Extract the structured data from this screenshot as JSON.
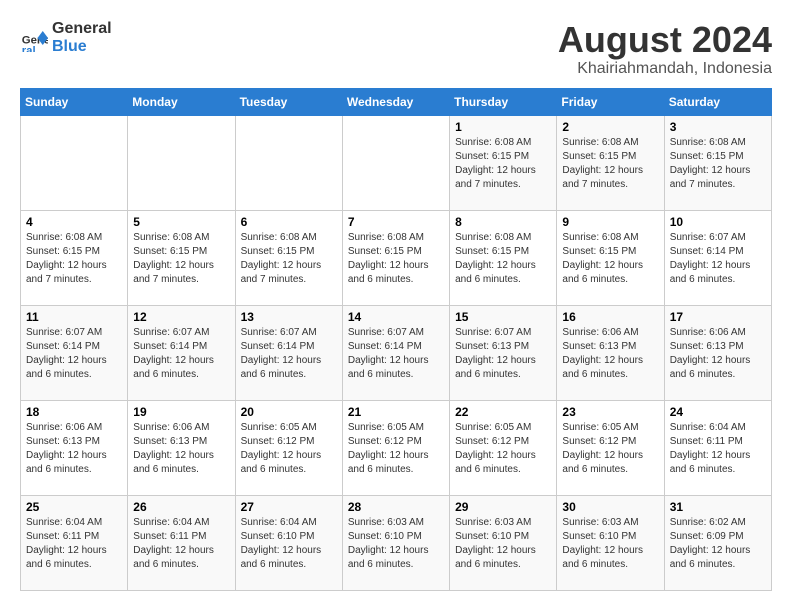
{
  "logo": {
    "line1": "General",
    "line2": "Blue"
  },
  "title": "August 2024",
  "subtitle": "Khairiahmandah, Indonesia",
  "days_header": [
    "Sunday",
    "Monday",
    "Tuesday",
    "Wednesday",
    "Thursday",
    "Friday",
    "Saturday"
  ],
  "weeks": [
    [
      {
        "day": "",
        "info": ""
      },
      {
        "day": "",
        "info": ""
      },
      {
        "day": "",
        "info": ""
      },
      {
        "day": "",
        "info": ""
      },
      {
        "day": "1",
        "info": "Sunrise: 6:08 AM\nSunset: 6:15 PM\nDaylight: 12 hours\nand 7 minutes."
      },
      {
        "day": "2",
        "info": "Sunrise: 6:08 AM\nSunset: 6:15 PM\nDaylight: 12 hours\nand 7 minutes."
      },
      {
        "day": "3",
        "info": "Sunrise: 6:08 AM\nSunset: 6:15 PM\nDaylight: 12 hours\nand 7 minutes."
      }
    ],
    [
      {
        "day": "4",
        "info": "Sunrise: 6:08 AM\nSunset: 6:15 PM\nDaylight: 12 hours\nand 7 minutes."
      },
      {
        "day": "5",
        "info": "Sunrise: 6:08 AM\nSunset: 6:15 PM\nDaylight: 12 hours\nand 7 minutes."
      },
      {
        "day": "6",
        "info": "Sunrise: 6:08 AM\nSunset: 6:15 PM\nDaylight: 12 hours\nand 7 minutes."
      },
      {
        "day": "7",
        "info": "Sunrise: 6:08 AM\nSunset: 6:15 PM\nDaylight: 12 hours\nand 6 minutes."
      },
      {
        "day": "8",
        "info": "Sunrise: 6:08 AM\nSunset: 6:15 PM\nDaylight: 12 hours\nand 6 minutes."
      },
      {
        "day": "9",
        "info": "Sunrise: 6:08 AM\nSunset: 6:15 PM\nDaylight: 12 hours\nand 6 minutes."
      },
      {
        "day": "10",
        "info": "Sunrise: 6:07 AM\nSunset: 6:14 PM\nDaylight: 12 hours\nand 6 minutes."
      }
    ],
    [
      {
        "day": "11",
        "info": "Sunrise: 6:07 AM\nSunset: 6:14 PM\nDaylight: 12 hours\nand 6 minutes."
      },
      {
        "day": "12",
        "info": "Sunrise: 6:07 AM\nSunset: 6:14 PM\nDaylight: 12 hours\nand 6 minutes."
      },
      {
        "day": "13",
        "info": "Sunrise: 6:07 AM\nSunset: 6:14 PM\nDaylight: 12 hours\nand 6 minutes."
      },
      {
        "day": "14",
        "info": "Sunrise: 6:07 AM\nSunset: 6:14 PM\nDaylight: 12 hours\nand 6 minutes."
      },
      {
        "day": "15",
        "info": "Sunrise: 6:07 AM\nSunset: 6:13 PM\nDaylight: 12 hours\nand 6 minutes."
      },
      {
        "day": "16",
        "info": "Sunrise: 6:06 AM\nSunset: 6:13 PM\nDaylight: 12 hours\nand 6 minutes."
      },
      {
        "day": "17",
        "info": "Sunrise: 6:06 AM\nSunset: 6:13 PM\nDaylight: 12 hours\nand 6 minutes."
      }
    ],
    [
      {
        "day": "18",
        "info": "Sunrise: 6:06 AM\nSunset: 6:13 PM\nDaylight: 12 hours\nand 6 minutes."
      },
      {
        "day": "19",
        "info": "Sunrise: 6:06 AM\nSunset: 6:13 PM\nDaylight: 12 hours\nand 6 minutes."
      },
      {
        "day": "20",
        "info": "Sunrise: 6:05 AM\nSunset: 6:12 PM\nDaylight: 12 hours\nand 6 minutes."
      },
      {
        "day": "21",
        "info": "Sunrise: 6:05 AM\nSunset: 6:12 PM\nDaylight: 12 hours\nand 6 minutes."
      },
      {
        "day": "22",
        "info": "Sunrise: 6:05 AM\nSunset: 6:12 PM\nDaylight: 12 hours\nand 6 minutes."
      },
      {
        "day": "23",
        "info": "Sunrise: 6:05 AM\nSunset: 6:12 PM\nDaylight: 12 hours\nand 6 minutes."
      },
      {
        "day": "24",
        "info": "Sunrise: 6:04 AM\nSunset: 6:11 PM\nDaylight: 12 hours\nand 6 minutes."
      }
    ],
    [
      {
        "day": "25",
        "info": "Sunrise: 6:04 AM\nSunset: 6:11 PM\nDaylight: 12 hours\nand 6 minutes."
      },
      {
        "day": "26",
        "info": "Sunrise: 6:04 AM\nSunset: 6:11 PM\nDaylight: 12 hours\nand 6 minutes."
      },
      {
        "day": "27",
        "info": "Sunrise: 6:04 AM\nSunset: 6:10 PM\nDaylight: 12 hours\nand 6 minutes."
      },
      {
        "day": "28",
        "info": "Sunrise: 6:03 AM\nSunset: 6:10 PM\nDaylight: 12 hours\nand 6 minutes."
      },
      {
        "day": "29",
        "info": "Sunrise: 6:03 AM\nSunset: 6:10 PM\nDaylight: 12 hours\nand 6 minutes."
      },
      {
        "day": "30",
        "info": "Sunrise: 6:03 AM\nSunset: 6:10 PM\nDaylight: 12 hours\nand 6 minutes."
      },
      {
        "day": "31",
        "info": "Sunrise: 6:02 AM\nSunset: 6:09 PM\nDaylight: 12 hours\nand 6 minutes."
      }
    ]
  ]
}
